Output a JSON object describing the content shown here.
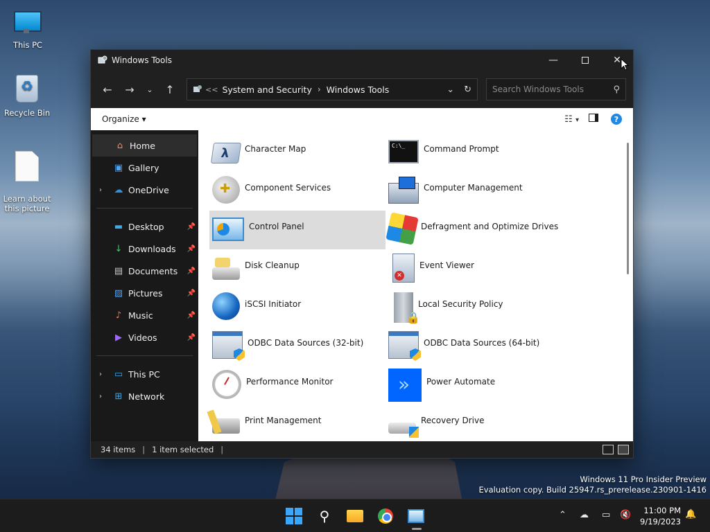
{
  "desktop": {
    "icons": [
      {
        "label": "This PC"
      },
      {
        "label": "Recycle Bin"
      },
      {
        "label": "Learn about\nthis picture"
      }
    ]
  },
  "window": {
    "title": "Windows Tools",
    "address": {
      "overflow": "<<",
      "crumbs": [
        "System and Security",
        "Windows Tools"
      ]
    },
    "search": {
      "placeholder": "Search Windows Tools"
    },
    "commandbar": {
      "organize_label": "Organize"
    },
    "sidebar": {
      "home": "Home",
      "gallery": "Gallery",
      "onedrive": "OneDrive",
      "quick_access": [
        "Desktop",
        "Downloads",
        "Documents",
        "Pictures",
        "Music",
        "Videos"
      ],
      "this_pc": "This PC",
      "network": "Network"
    },
    "items": [
      {
        "label": "Character Map",
        "icon": "character-map-icon"
      },
      {
        "label": "Command Prompt",
        "icon": "command-prompt-icon"
      },
      {
        "label": "Component Services",
        "icon": "component-services-icon"
      },
      {
        "label": "Computer Management",
        "icon": "computer-management-icon"
      },
      {
        "label": "Control Panel",
        "icon": "control-panel-icon",
        "selected": true
      },
      {
        "label": "Defragment and Optimize Drives",
        "icon": "defrag-icon"
      },
      {
        "label": "Disk Cleanup",
        "icon": "disk-cleanup-icon"
      },
      {
        "label": "Event Viewer",
        "icon": "event-viewer-icon"
      },
      {
        "label": "iSCSI Initiator",
        "icon": "iscsi-icon"
      },
      {
        "label": "Local Security Policy",
        "icon": "local-security-policy-icon"
      },
      {
        "label": "ODBC Data Sources (32-bit)",
        "icon": "odbc-32-icon"
      },
      {
        "label": "ODBC Data Sources (64-bit)",
        "icon": "odbc-64-icon"
      },
      {
        "label": "Performance Monitor",
        "icon": "performance-monitor-icon"
      },
      {
        "label": "Power Automate",
        "icon": "power-automate-icon"
      },
      {
        "label": "Print Management",
        "icon": "print-management-icon"
      },
      {
        "label": "Recovery Drive",
        "icon": "recovery-drive-icon"
      }
    ],
    "status": {
      "item_count": "34 items",
      "selection": "1 item selected"
    }
  },
  "watermark": {
    "line1": "Windows 11 Pro Insider Preview",
    "line2": "Evaluation copy. Build 25947.rs_prerelease.230901-1416"
  },
  "taskbar": {
    "time": "11:00 PM",
    "date": "9/19/2023"
  },
  "colors": {
    "accent": "#1e88e5",
    "window_bg": "#202020",
    "selected_item": "#dcdcdc"
  }
}
